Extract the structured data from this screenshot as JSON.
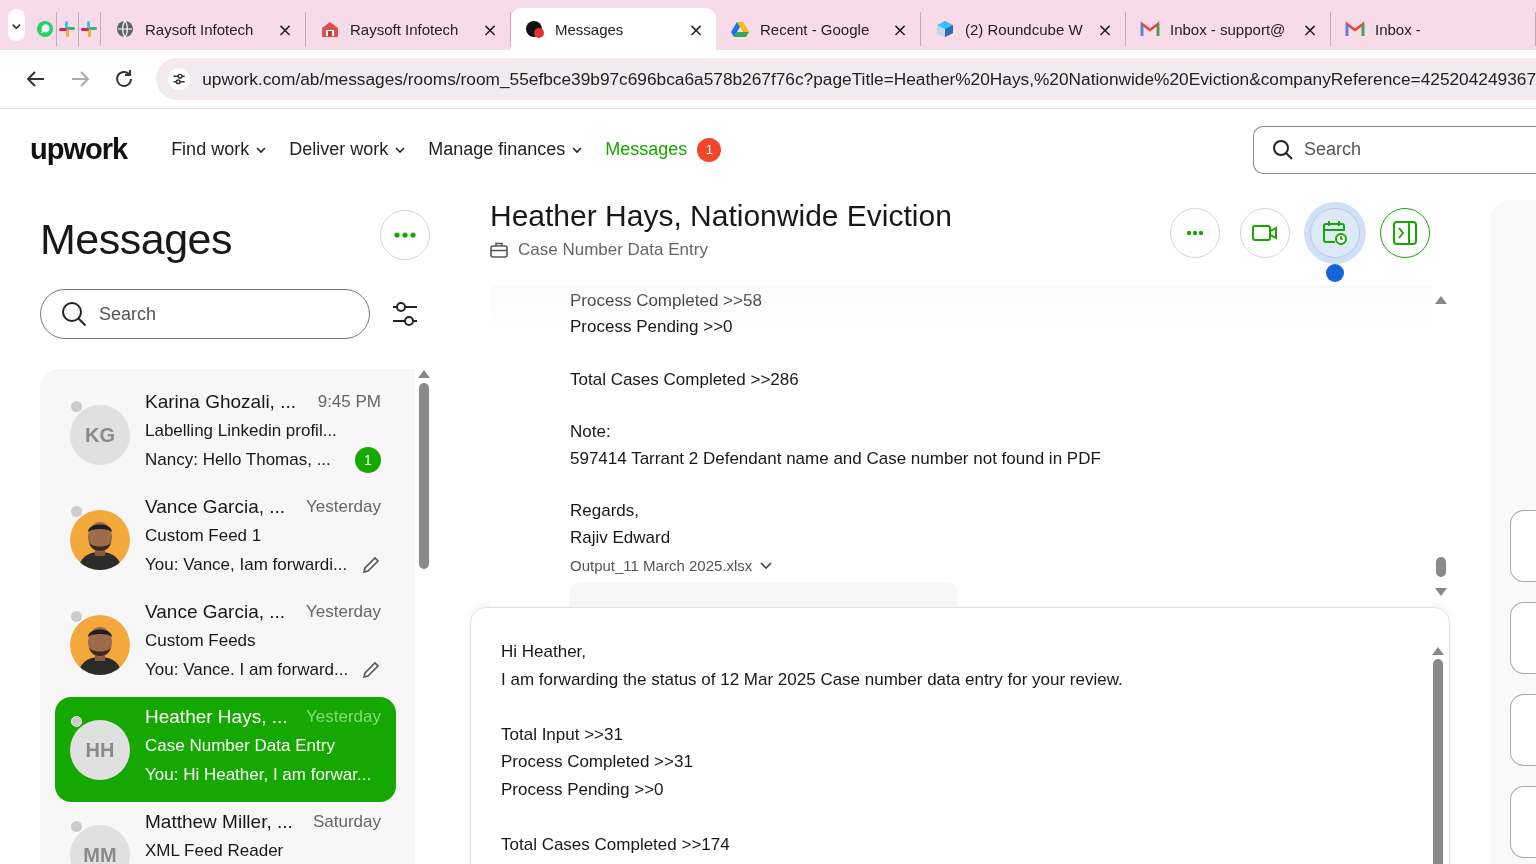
{
  "browser": {
    "tab_menu": "⌄",
    "tabs": [
      {
        "title": "Raysoft Infotech",
        "selected": false,
        "close": "×"
      },
      {
        "title": "Raysoft Infotech",
        "selected": false,
        "close": "×"
      },
      {
        "title": "Messages",
        "selected": true,
        "close": "×"
      },
      {
        "title": "Recent - Google",
        "selected": false,
        "close": "×"
      },
      {
        "title": "(2) Roundcube W",
        "selected": false,
        "close": "×"
      },
      {
        "title": "Inbox - support@",
        "selected": false,
        "close": "×"
      },
      {
        "title": "Inbox -",
        "selected": false
      }
    ],
    "url": "upwork.com/ab/messages/rooms/room_55efbce39b97c696bca6a578b267f76c?pageTitle=Heather%20Hays,%20Nationwide%20Eviction&companyReference=425204249367"
  },
  "header": {
    "logo": "upwork",
    "nav": [
      {
        "label": "Find work",
        "dropdown": true,
        "selected": false
      },
      {
        "label": "Deliver work",
        "dropdown": true,
        "selected": false
      },
      {
        "label": "Manage finances",
        "dropdown": true,
        "selected": false
      },
      {
        "label": "Messages",
        "dropdown": false,
        "selected": true,
        "badge": "1"
      }
    ],
    "search": {
      "placeholder": "Search"
    }
  },
  "sidebar": {
    "title": "Messages",
    "search": {
      "placeholder": "Search"
    },
    "conversations": [
      {
        "avatar": {
          "kind": "initials",
          "text": "KG"
        },
        "name": "Karina Ghozali, ...",
        "time": "9:45 PM",
        "title": "Labelling Linkedin profil...",
        "preview": "Nancy: Hello Thomas, ...",
        "unread": "1",
        "draft": false,
        "selected": false
      },
      {
        "name": "Vance Garcia, ...",
        "time": "Yesterday",
        "title": "Custom Feed 1",
        "preview": "You: Vance, Iam forwardi...",
        "draft": true,
        "selected": false
      },
      {
        "name": "Vance Garcia, ...",
        "time": "Yesterday",
        "title": "Custom Feeds",
        "preview": "You: Vance. I am forward...",
        "draft": true,
        "selected": false
      },
      {
        "avatar": {
          "kind": "initials",
          "text": "HH"
        },
        "name": "Heather Hays, ...",
        "time": "Yesterday",
        "title": "Case Number Data Entry",
        "preview": "You: Hi Heather, I am forwar...",
        "draft": false,
        "selected": true
      },
      {
        "avatar": {
          "kind": "initials",
          "text": "MM"
        },
        "name": "Matthew Miller, ...",
        "time": "Saturday",
        "title": "XML Feed Reader",
        "draft": false,
        "selected": false
      }
    ]
  },
  "chat": {
    "title": "Heather Hays, Nationwide Eviction",
    "subtitle": "Case Number Data Entry",
    "actions": [
      {
        "highlighted": false
      },
      {
        "highlighted": false
      },
      {
        "highlighted": true
      },
      {
        "highlighted": false
      }
    ],
    "message_blocks": [
      [
        "Process Completed >>58",
        "Process Pending >>0"
      ],
      [
        "Total Cases Completed >>286"
      ],
      [
        "Note:",
        "597414 Tarrant 2 Defendant name and Case number not found in PDF"
      ],
      [
        "Regards,",
        "Rajiv Edward"
      ]
    ],
    "attachment": {
      "label": "Output_11 March 2025.xlsx"
    },
    "composer": {
      "value": "Hi Heather,\nI am forwarding the status of 12 Mar 2025 Case number data entry for your review.\n\nTotal Input >>31\nProcess Completed >>31\nProcess Pending >>0\n\nTotal Cases Completed >>174"
    }
  }
}
